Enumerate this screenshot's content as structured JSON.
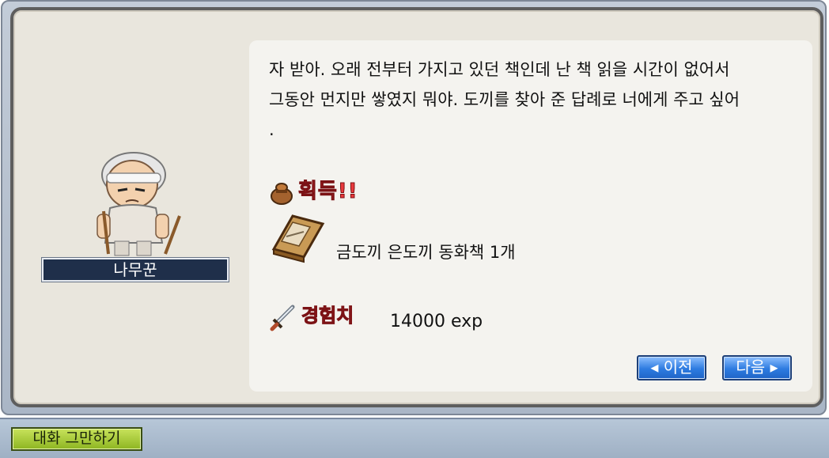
{
  "npc": {
    "name": "나무꾼"
  },
  "dialog": {
    "message": "자 받아. 오래 전부터 가지고 있던 책인데 난 책 읽을 시간이 없어서\n그동안 먼지만 쌓였지 뭐야. 도끼를 찾아 준 답례로 너에게 주고 싶어\n.",
    "reward_label": "획득!!",
    "reward_item": "금도끼 은도끼 동화책 1개",
    "exp_label": "경험치",
    "exp_value": "14000 exp"
  },
  "buttons": {
    "prev": "◂ 이전",
    "next": "다음 ▸",
    "end_chat": "대화 그만하기"
  },
  "icons": {
    "reward": "bag-icon",
    "item": "book-icon",
    "exp": "sword-icon"
  },
  "colors": {
    "accent_red": "#e8383c",
    "button_blue": "#2d7be0",
    "end_button_green": "#8db521",
    "name_bar": "#1f2f4a"
  }
}
